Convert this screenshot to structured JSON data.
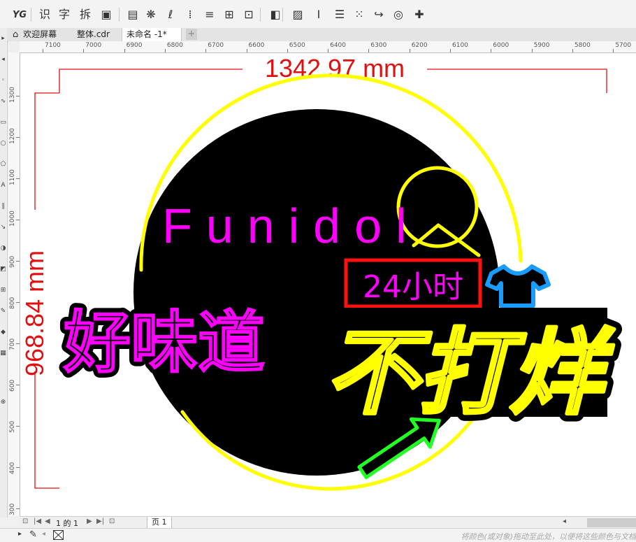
{
  "toolbar": {
    "items": [
      {
        "name": "yg-icon",
        "glyph": "YG"
      },
      {
        "name": "recognize-button",
        "glyph": "识"
      },
      {
        "name": "character-button",
        "glyph": "字"
      },
      {
        "name": "split-button",
        "glyph": "拆"
      },
      {
        "name": "copy-icon",
        "glyph": "▣"
      },
      {
        "name": "table-icon",
        "glyph": "▤"
      },
      {
        "name": "pattern-icon",
        "glyph": "❋"
      },
      {
        "name": "curve-icon",
        "glyph": "ℓ"
      },
      {
        "name": "align-icon",
        "glyph": "⁞"
      },
      {
        "name": "lines-icon",
        "glyph": "≡"
      },
      {
        "name": "distribute-icon",
        "glyph": "⊞"
      },
      {
        "name": "bbox-icon",
        "glyph": "⊡"
      },
      {
        "name": "arrange-icon",
        "glyph": "◧"
      },
      {
        "name": "image-icon",
        "glyph": "▨"
      },
      {
        "name": "text-height-icon",
        "glyph": "Ⅰ"
      },
      {
        "name": "list-icon",
        "glyph": "☰"
      },
      {
        "name": "dots-icon",
        "glyph": "⁙"
      },
      {
        "name": "reshape-icon",
        "glyph": "↪"
      },
      {
        "name": "globe-icon",
        "glyph": "◎"
      },
      {
        "name": "plugin-icon",
        "glyph": "✚"
      }
    ]
  },
  "tabs": [
    {
      "label": "欢迎屏幕"
    },
    {
      "label": "整体.cdr"
    },
    {
      "label": "未命名 -1*"
    }
  ],
  "tab_add_glyph": "+",
  "ruler_h": [
    "7100",
    "7000",
    "6900",
    "6800",
    "6700",
    "6600",
    "6500",
    "6400",
    "6300",
    "6200",
    "6100",
    "6000",
    "5900",
    "5800",
    "5700"
  ],
  "ruler_v": [
    "1300",
    "1200",
    "1100",
    "1000",
    "900",
    "800",
    "700",
    "600",
    "500",
    "400",
    "300"
  ],
  "design": {
    "width_dim": "1342.97 mm",
    "height_dim": "968.84 mm",
    "brand": "Funidol",
    "slogan": "好味道",
    "badge": "24小时",
    "headline": "不打烊",
    "colors": {
      "dimension": "#e01010",
      "magenta": "#ff00ff",
      "yellow": "#ffff00",
      "blue": "#1a9cff",
      "green": "#22ff22",
      "red": "#ff1010",
      "black": "#000000"
    }
  },
  "page_nav": {
    "counter": "1 的 1",
    "page_label": "页 1"
  },
  "status": {
    "hint": "将颜色(或对象)拖动至此处，以便将这些颜色与文档"
  }
}
